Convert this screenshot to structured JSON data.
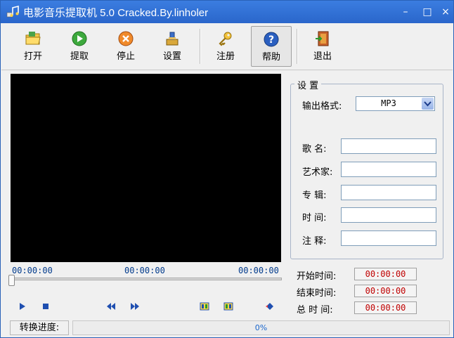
{
  "window": {
    "title": "电影音乐提取机 5.0  Cracked.By.linholer",
    "controls": {
      "minimize": "–",
      "maximize": "□",
      "close": "×"
    }
  },
  "toolbar": {
    "open_label": "打开",
    "extract_label": "提取",
    "stop_label": "停止",
    "settings_label": "设置",
    "register_label": "注册",
    "help_label": "帮助",
    "exit_label": "退出"
  },
  "player": {
    "time_start": "00:00:00",
    "time_current": "00:00:00",
    "time_end": "00:00:00",
    "seek_position": 0
  },
  "settings": {
    "legend": "设 置",
    "output_format_label": "输出格式:",
    "output_format_value": "MP3",
    "song_label": "歌  名:",
    "artist_label": "艺术家:",
    "album_label": "专  辑:",
    "time_label": "时  间:",
    "comment_label": "注  释:",
    "song_value": "",
    "artist_value": "",
    "album_value": "",
    "time_value": "",
    "comment_value": ""
  },
  "range": {
    "start_label": "开始时间:",
    "start_value": "00:00:00",
    "end_label": "结束时间:",
    "end_value": "00:00:00",
    "total_label": "总 时 间:",
    "total_value": "00:00:00"
  },
  "progress": {
    "label": "转换进度:",
    "percent_text": "0%",
    "value": 0
  },
  "colors": {
    "titlebar": "#2a66cb",
    "time_text": "#003a8c",
    "time_value_text": "#c00000",
    "progress_text": "#1a66cc"
  }
}
